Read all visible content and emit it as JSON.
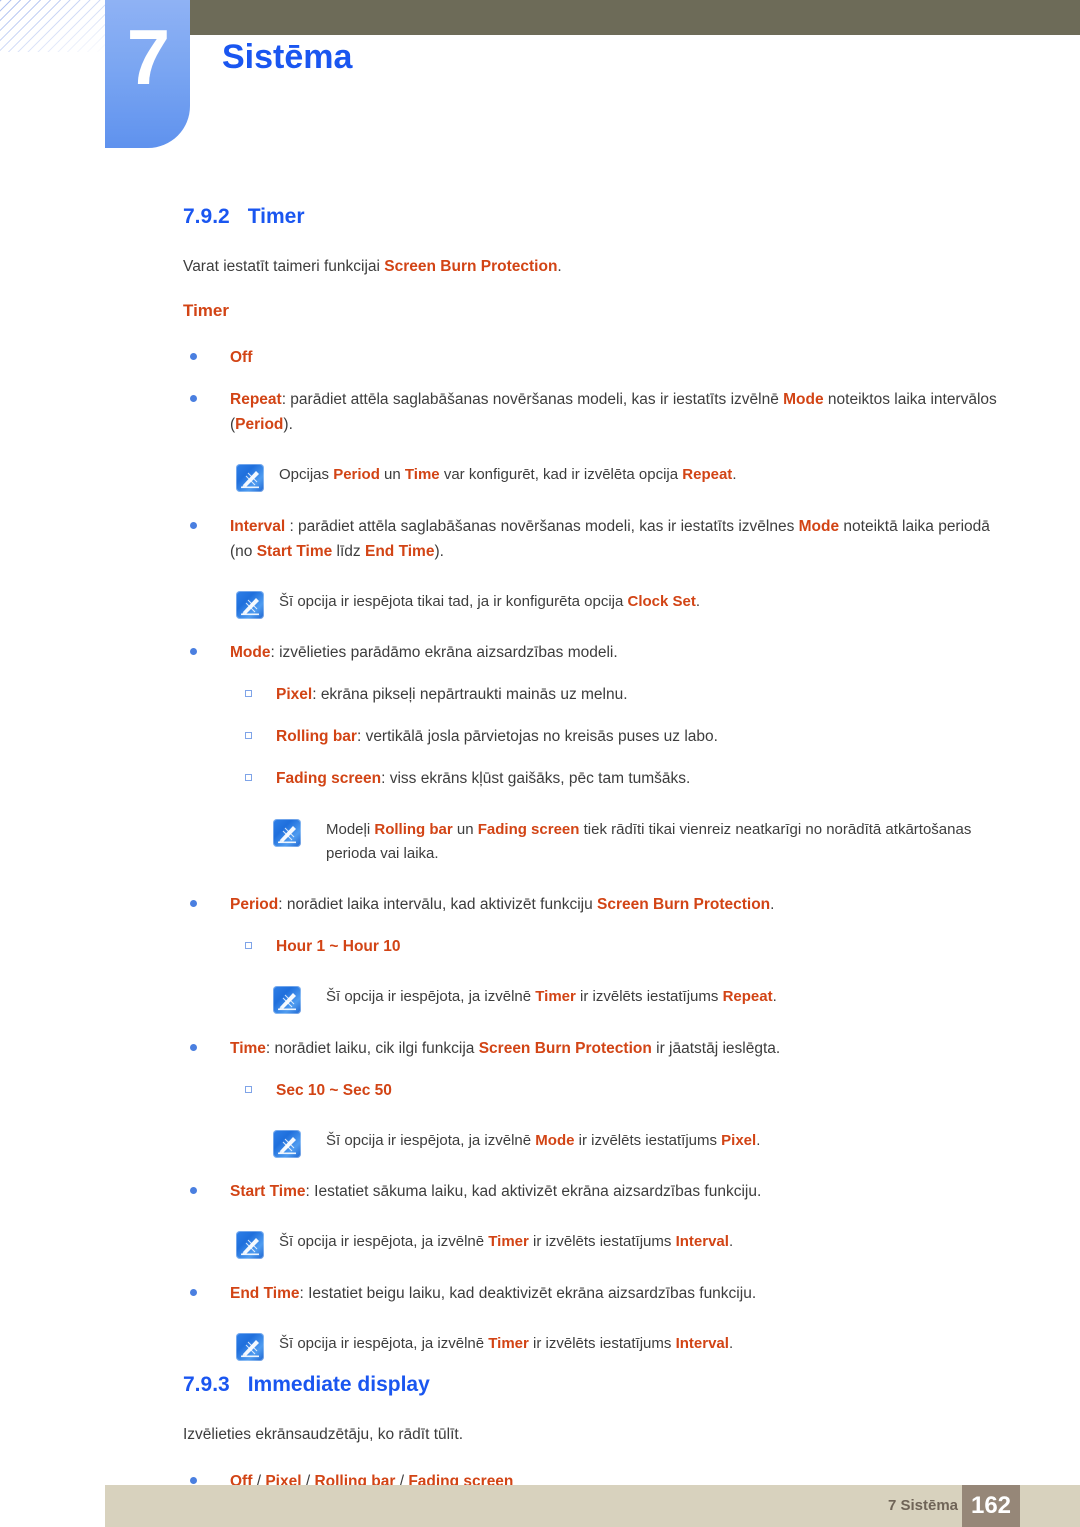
{
  "header": {
    "chapter_number": "7",
    "chapter_title": "Sistēma"
  },
  "sections": [
    {
      "number": "7.9.2",
      "title": "Timer",
      "intro_pre": "Varat iestatīt taimeri funkcijai ",
      "intro_term": "Screen Burn Protection",
      "intro_post": ".",
      "subheading": "Timer"
    },
    {
      "number": "7.9.3",
      "title": "Immediate display",
      "intro": "Izvēlieties ekrānsaudzētāju, ko rādīt tūlīt."
    }
  ],
  "bullets": {
    "off": "Off",
    "repeat_term": "Repeat",
    "repeat_text_1": ": parādiet attēla saglabāšanas novēršanas modeli, kas ir iestatīts izvēlnē ",
    "repeat_mode": "Mode",
    "repeat_text_2": " noteiktos laika intervālos (",
    "repeat_period": "Period",
    "repeat_text_3": ").",
    "interval_term": "Interval",
    "interval_text_1": " : parādiet attēla saglabāšanas novēršanas modeli, kas ir iestatīts izvēlnes ",
    "interval_mode": "Mode",
    "interval_text_2": " noteiktā laika periodā (no ",
    "interval_start": "Start Time",
    "interval_text_3": " līdz ",
    "interval_end": "End Time",
    "interval_text_4": ").",
    "mode_term": "Mode",
    "mode_text": ": izvēlieties parādāmo ekrāna aizsardzības modeli.",
    "pixel_term": "Pixel",
    "pixel_text": ": ekrāna pikseļi nepārtraukti mainās uz melnu.",
    "rollingbar_term": "Rolling bar",
    "rollingbar_text": ": vertikālā josla pārvietojas no kreisās puses uz labo.",
    "fading_term": "Fading screen",
    "fading_text": ": viss ekrāns kļūst gaišāks, pēc tam tumšāks.",
    "period_term": "Period",
    "period_text_1": ": norādiet laika intervālu, kad aktivizēt funkciju ",
    "period_sbp": "Screen Burn Protection",
    "period_text_2": ".",
    "hour_range": "Hour 1 ~ Hour 10",
    "time_term": "Time",
    "time_text_1": ": norādiet laiku, cik ilgi funkcija ",
    "time_sbp": "Screen Burn Protection",
    "time_text_2": " ir jāatstāj ieslēgta.",
    "sec_range": "Sec 10 ~ Sec 50",
    "starttime_term": "Start Time",
    "starttime_text": ": Iestatiet sākuma laiku, kad aktivizēt ekrāna aizsardzības funkciju.",
    "endtime_term": "End Time",
    "endtime_text": ": Iestatiet beigu laiku, kad deaktivizēt ekrāna aizsardzības funkciju.",
    "immediate_off": "Off",
    "immediate_sep1": " / ",
    "immediate_pixel": "Pixel",
    "immediate_sep2": " / ",
    "immediate_rollingbar": "Rolling bar",
    "immediate_sep3": " / ",
    "immediate_fading": "Fading screen"
  },
  "notes": {
    "note1_pre": "Opcijas ",
    "note1_period": "Period",
    "note1_mid": " un ",
    "note1_time": "Time",
    "note1_post": " var konfigurēt, kad ir izvēlēta opcija ",
    "note1_repeat": "Repeat",
    "note1_end": ".",
    "note2_pre": "Šī opcija ir iespējota tikai tad, ja ir konfigurēta opcija ",
    "note2_term": "Clock Set",
    "note2_end": ".",
    "note3_pre": "Modeļi ",
    "note3_rollingbar": "Rolling bar",
    "note3_mid": " un ",
    "note3_fading": "Fading screen",
    "note3_post": " tiek rādīti tikai vienreiz neatkarīgi no norādītā atkārtošanas perioda vai laika.",
    "note4_pre": "Šī opcija ir iespējota, ja izvēlnē ",
    "note4_timer": "Timer",
    "note4_mid": " ir izvēlēts iestatījums ",
    "note4_repeat": "Repeat",
    "note4_end": ".",
    "note5_pre": "Šī opcija ir iespējota, ja izvēlnē ",
    "note5_mode": "Mode",
    "note5_mid": " ir izvēlēts iestatījums ",
    "note5_pixel": "Pixel",
    "note5_end": ".",
    "note6_pre": "Šī opcija ir iespējota, ja izvēlnē ",
    "note6_timer": "Timer",
    "note6_mid": " ir izvēlēts iestatījums ",
    "note6_interval": "Interval",
    "note6_end": ".",
    "note7_pre": "Šī opcija ir iespējota, ja izvēlnē ",
    "note7_timer": "Timer",
    "note7_mid": " ir izvēlēts iestatījums ",
    "note7_interval": "Interval",
    "note7_end": "."
  },
  "footer": {
    "label": "7 Sistēma",
    "page": "162"
  },
  "colors": {
    "heading_blue": "#1a56f0",
    "term_orange": "#d24415",
    "body_gray": "#3d3d3d",
    "olive_bar": "#6d6b58",
    "tab_blue": "#6f9cf0",
    "footer_beige": "#d8d2be",
    "footer_page_box": "#968778"
  }
}
